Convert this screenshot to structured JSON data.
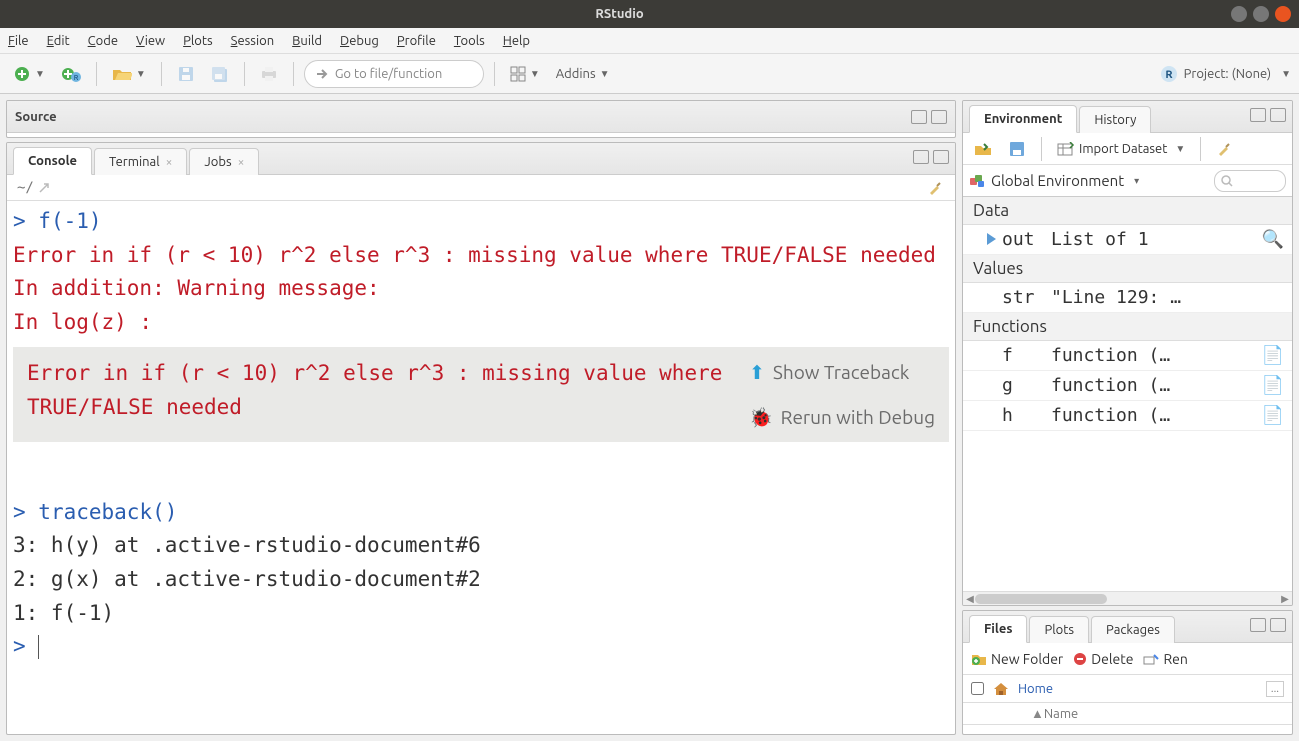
{
  "window": {
    "title": "RStudio"
  },
  "menu": [
    "File",
    "Edit",
    "Code",
    "View",
    "Plots",
    "Session",
    "Build",
    "Debug",
    "Profile",
    "Tools",
    "Help"
  ],
  "toolbar": {
    "goto_placeholder": "Go to file/function",
    "addins_label": "Addins",
    "project_label": "Project: (None)"
  },
  "panes": {
    "source": {
      "title": "Source"
    },
    "console": {
      "tabs": [
        "Console",
        "Terminal",
        "Jobs"
      ],
      "active": 0,
      "cwd": "~/",
      "lines": [
        {
          "t": "prompt",
          "s": "> "
        },
        {
          "t": "cmd",
          "s": "f(-1)"
        },
        {
          "t": "br"
        },
        {
          "t": "err",
          "s": "Error in if (r < 10) r^2 else r^3 : missing value where TRUE/FALSE needed"
        },
        {
          "t": "br"
        },
        {
          "t": "err",
          "s": "In addition: Warning message:"
        },
        {
          "t": "br"
        },
        {
          "t": "err",
          "s": "In log(z) :"
        },
        {
          "t": "br"
        }
      ],
      "errorbox": {
        "msg": "Error in if (r < 10) r^2 else r^3 : missing value where TRUE/FALSE needed",
        "show_traceback": "Show Traceback",
        "rerun_debug": "Rerun with Debug"
      },
      "lines2": [
        {
          "t": "br"
        },
        {
          "t": "prompt",
          "s": "> "
        },
        {
          "t": "cmd",
          "s": "traceback()"
        },
        {
          "t": "br"
        },
        {
          "t": "out",
          "s": "3: h(y) at .active-rstudio-document#6"
        },
        {
          "t": "br"
        },
        {
          "t": "out",
          "s": "2: g(x) at .active-rstudio-document#2"
        },
        {
          "t": "br"
        },
        {
          "t": "out",
          "s": "1: f(-1)"
        },
        {
          "t": "br"
        },
        {
          "t": "prompt",
          "s": "> "
        },
        {
          "t": "cursor"
        }
      ]
    },
    "env": {
      "tabs": [
        "Environment",
        "History"
      ],
      "import_label": "Import Dataset",
      "scope_label": "Global Environment",
      "sections": [
        {
          "title": "Data",
          "rows": [
            {
              "name": "out",
              "val": "List of 1",
              "expandable": true,
              "icon": "search"
            }
          ]
        },
        {
          "title": "Values",
          "rows": [
            {
              "name": "str",
              "val": "\"Line 129: …"
            }
          ]
        },
        {
          "title": "Functions",
          "rows": [
            {
              "name": "f",
              "val": "function (…",
              "icon": "doc"
            },
            {
              "name": "g",
              "val": "function (…",
              "icon": "doc"
            },
            {
              "name": "h",
              "val": "function (…",
              "icon": "doc"
            }
          ]
        }
      ]
    },
    "files": {
      "tabs": [
        "Files",
        "Plots",
        "Packages"
      ],
      "newfolder": "New Folder",
      "delete": "Delete",
      "rename": "Ren",
      "home": "Home",
      "colname": "Name"
    }
  }
}
